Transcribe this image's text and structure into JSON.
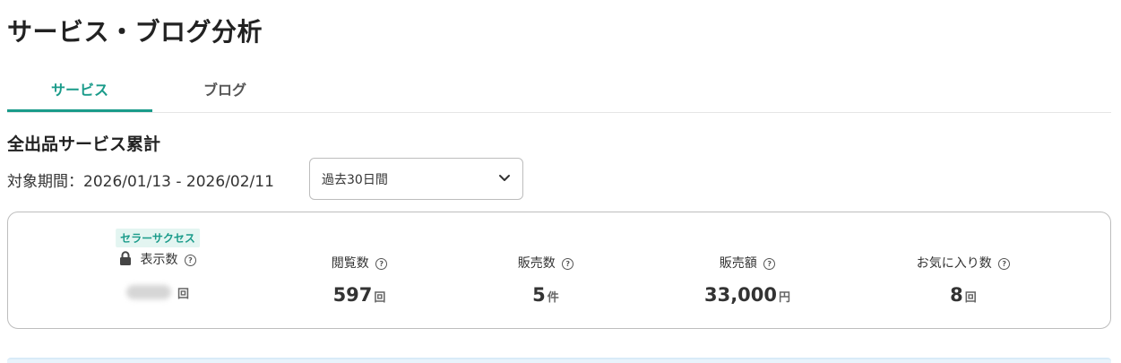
{
  "page": {
    "title": "サービス・ブログ分析"
  },
  "tabs": [
    {
      "label": "サービス",
      "active": true
    },
    {
      "label": "ブログ",
      "active": false
    }
  ],
  "section": {
    "title": "全出品サービス累計",
    "period_label": "対象期間：2026/01/13 - 2026/02/11",
    "period_select": "過去30日間"
  },
  "stats": {
    "views": {
      "badge": "セラーサクセス",
      "label": "表示数",
      "unit": "回",
      "locked": true
    },
    "page_views": {
      "label": "閲覧数",
      "value": "597",
      "unit": "回"
    },
    "sales_count": {
      "label": "販売数",
      "value": "5",
      "unit": "件"
    },
    "sales_amount": {
      "label": "販売額",
      "value": "33,000",
      "unit": "円"
    },
    "favorites": {
      "label": "お気に入り数",
      "value": "8",
      "unit": "回"
    }
  },
  "colors": {
    "accent": "#1a9b8a",
    "badge_bg": "#e3f5f1",
    "border": "#bdbdbd",
    "text": "#333333"
  }
}
